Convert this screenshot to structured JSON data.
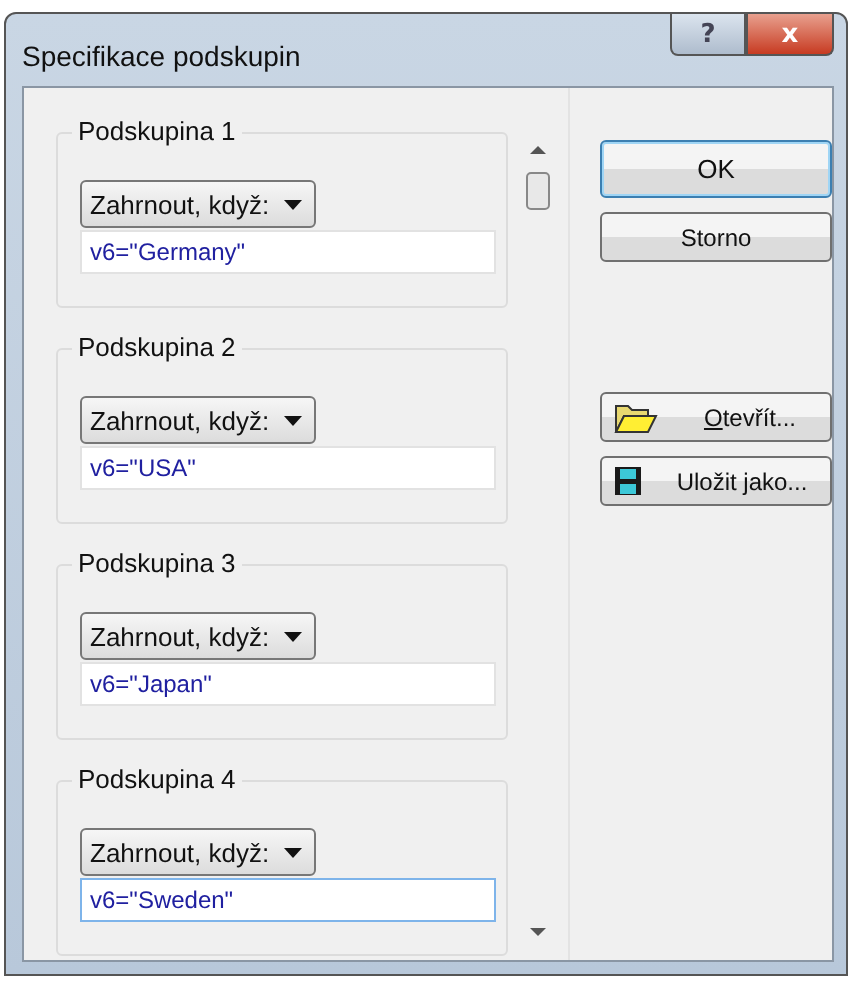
{
  "window": {
    "title": "Specifikace podskupin",
    "title_buttons": [
      "?",
      "x"
    ]
  },
  "subgroups": [
    {
      "title": "Podskupina 1",
      "mode": "Zahrnout, když:",
      "condition": "v6=\"Germany\"",
      "focused": false
    },
    {
      "title": "Podskupina 2",
      "mode": "Zahrnout, když:",
      "condition": "v6=\"USA\"",
      "focused": false
    },
    {
      "title": "Podskupina 3",
      "mode": "Zahrnout, když:",
      "condition": "v6=\"Japan\"",
      "focused": false
    },
    {
      "title": "Podskupina 4",
      "mode": "Zahrnout, když:",
      "condition": "v6=\"Sweden\"",
      "focused": true
    }
  ],
  "buttons": [
    {
      "kind": "default",
      "before": "OK"
    },
    {
      "kind": "plain",
      "before": "Storno"
    },
    {
      "kind": "open",
      "key": "O",
      "after": "tevřít..."
    },
    {
      "kind": "save",
      "before": "Uložit ",
      "key": "j",
      "after": "ako..."
    }
  ]
}
